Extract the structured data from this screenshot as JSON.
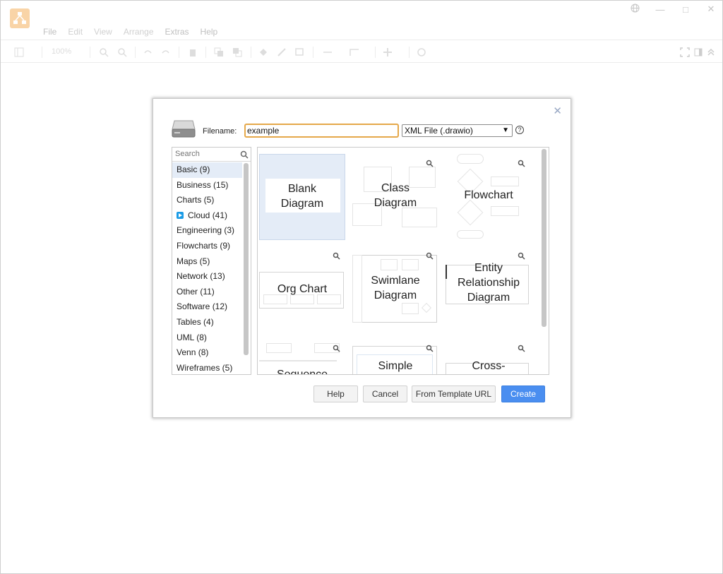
{
  "menu": [
    "File",
    "Edit",
    "View",
    "Arrange",
    "Extras",
    "Help"
  ],
  "toolbar": {
    "zoom": "100%"
  },
  "dialog": {
    "filename_label": "Filename:",
    "filename_value": "example",
    "format": "XML File (.drawio)",
    "search_placeholder": "Search",
    "categories": [
      "Basic (9)",
      "Business (15)",
      "Charts (5)",
      "Cloud (41)",
      "Engineering (3)",
      "Flowcharts (9)",
      "Maps (5)",
      "Network (13)",
      "Other (11)",
      "Software (12)",
      "Tables (4)",
      "UML (8)",
      "Venn (8)",
      "Wireframes (5)"
    ],
    "templates": {
      "blank": [
        "Blank",
        "Diagram"
      ],
      "class": [
        "Class",
        "Diagram"
      ],
      "flowchart": [
        "Flowchart"
      ],
      "org": [
        "Org Chart"
      ],
      "swimlane": [
        "Swimlane",
        "Diagram"
      ],
      "er": [
        "Entity",
        "Relationship",
        "Diagram"
      ],
      "sequence": [
        "Sequence"
      ],
      "simple": [
        "Simple"
      ],
      "cross": [
        "Cross-"
      ]
    },
    "buttons": {
      "help": "Help",
      "cancel": "Cancel",
      "template_url": "From Template URL",
      "create": "Create"
    }
  },
  "colors": {
    "accent": "#4a8ef0",
    "focus": "#e5a84a",
    "selected": "#e4ecf7"
  },
  "icons": [
    "drawio-logo-icon",
    "globe-icon",
    "minimize-icon",
    "maximize-icon",
    "close-icon",
    "drive-icon",
    "help-icon",
    "search-icon",
    "zoom-icon"
  ]
}
